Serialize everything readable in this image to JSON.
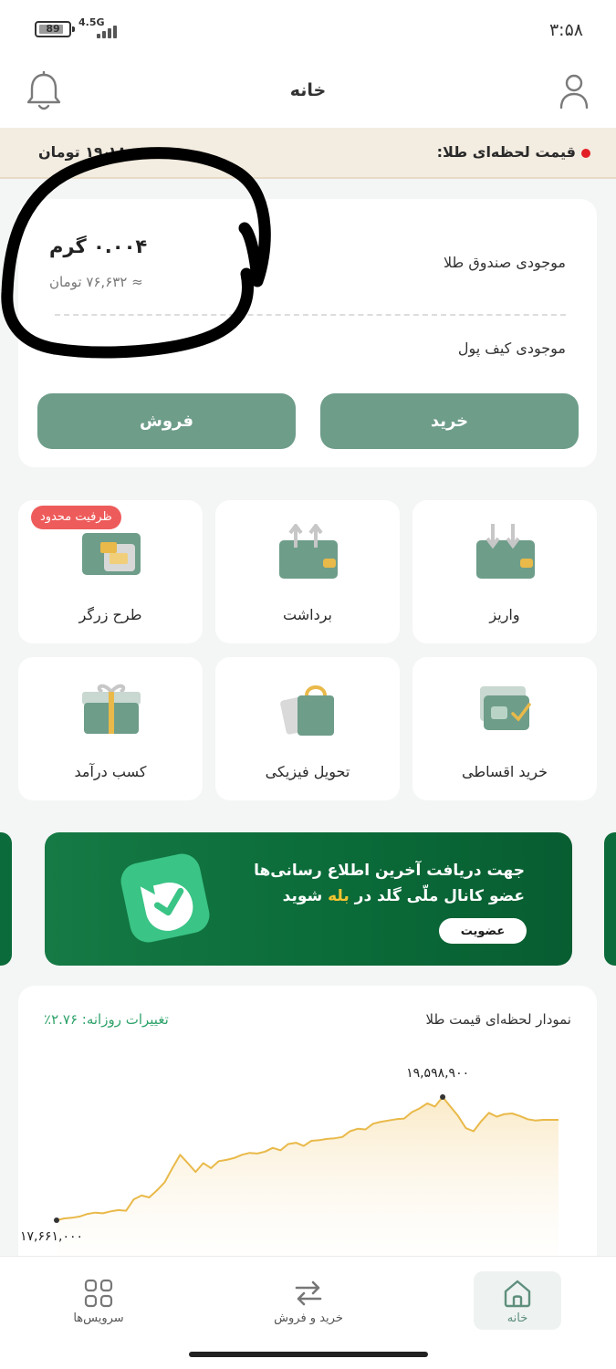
{
  "status": {
    "time": "۳:۵۸",
    "battery": "89",
    "network": "4.5G"
  },
  "header": {
    "title": "خانه"
  },
  "gold_price": {
    "label": "قیمت لحظه‌ای طلا:",
    "value": "۱۹،۱۸۰ تومان"
  },
  "balance": {
    "gold_box_label": "موجودی صندوق طلا",
    "grams": "۰.۰۰۴ گرم",
    "toman": "≈ ۷۶,۶۳۲ تومان",
    "wallet_label": "موجودی کیف پول",
    "buy": "خرید",
    "sell": "فروش"
  },
  "services": [
    {
      "label": "واریز",
      "icon": "deposit-wallet-icon"
    },
    {
      "label": "برداشت",
      "icon": "withdraw-wallet-icon"
    },
    {
      "label": "طرح زرگر",
      "icon": "gold-bars-icon",
      "badge": "ظرفیت محدود"
    },
    {
      "label": "خرید اقساطی",
      "icon": "installment-card-icon"
    },
    {
      "label": "تحویل فیزیکی",
      "icon": "shopping-bag-icon"
    },
    {
      "label": "کسب درآمد",
      "icon": "gift-icon"
    }
  ],
  "banner": {
    "line1": "جهت دریافت آخرین اطلاع رسانی‌ها",
    "line2_a": "عضو کانال ملّی گلد در ",
    "line2_hl": "بله",
    "line2_b": " شوید",
    "button": "عضویت"
  },
  "chart": {
    "title": "نمودار لحظه‌ای قیمت طلا",
    "change": "تغییرات روزانه: ۲.۷۶٪",
    "max_label": "۱۹,۵۹۸,۹۰۰",
    "min_label": "۱۷,۶۶۱,۰۰۰",
    "color": "#e9b949"
  },
  "chart_data": {
    "type": "line",
    "title": "نمودار لحظه‌ای قیمت طلا",
    "xlabel": "",
    "ylabel": "",
    "ylim": [
      17661000,
      19598900
    ],
    "grid": false,
    "series": [
      {
        "values": [
          17661000,
          17690000,
          17700000,
          17720000,
          17760000,
          17780000,
          17770000,
          17800000,
          17820000,
          17810000,
          17990000,
          18050000,
          18020000,
          18130000,
          18260000,
          18480000,
          18690000,
          18560000,
          18420000,
          18560000,
          18480000,
          18590000,
          18610000,
          18640000,
          18690000,
          18720000,
          18710000,
          18740000,
          18800000,
          18760000,
          18860000,
          18880000,
          18830000,
          18910000,
          18920000,
          18940000,
          18950000,
          18970000,
          19060000,
          19100000,
          19090000,
          19180000,
          19210000,
          19230000,
          19250000,
          19260000,
          19360000,
          19420000,
          19500000,
          19450000,
          19598900,
          19450000,
          19300000,
          19110000,
          19060000,
          19220000,
          19350000,
          19290000,
          19330000,
          19340000,
          19300000,
          19250000,
          19230000,
          19240000,
          19240000,
          19240000
        ]
      }
    ]
  },
  "nav": {
    "home": "خانه",
    "trade": "خرید و فروش",
    "services": "سرویس‌ها"
  }
}
